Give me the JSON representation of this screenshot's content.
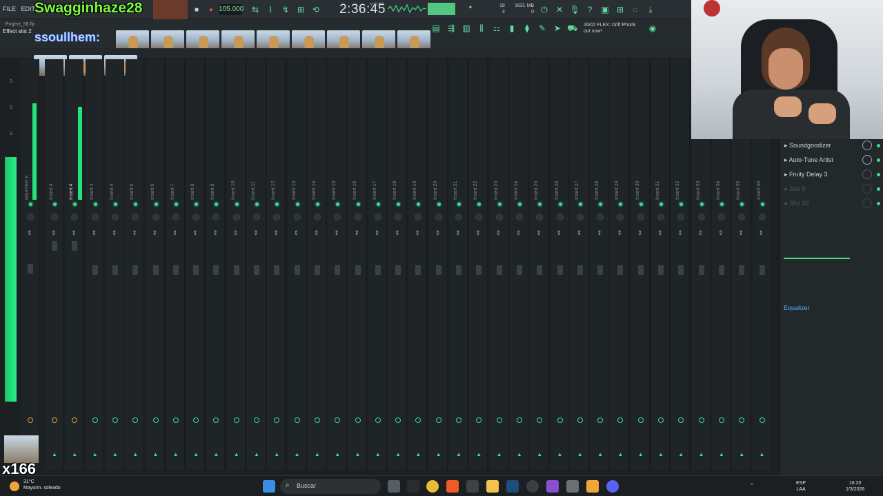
{
  "toolbar": {
    "menu": [
      "FILE",
      "EDIT",
      "AD"
    ],
    "tempo": "105.000",
    "time": "2:36:45",
    "time_sub": "M:S:CS",
    "cpu_num": "18",
    "cpu_voices": "3",
    "memory_mb": "1631 MB",
    "memory_val": "0",
    "news_line1": "26/02  FLEX: Drift Phonk",
    "news_line2": "out now!"
  },
  "project": {
    "name": "Project_56.flp",
    "slot": "Effect slot 2"
  },
  "chat": {
    "user1": "Swagginhaze28",
    "user2": "ssoullhem:"
  },
  "mixer": {
    "master_label": "MASTER K",
    "insert_labels": [
      "Insert 4",
      "Insert 4",
      "Insert 3",
      "Insert 4",
      "Insert 5",
      "Insert 6",
      "Insert 7",
      "Insert 8",
      "Insert 9",
      "Insert 10",
      "Insert 11",
      "Insert 12",
      "Insert 13",
      "Insert 14",
      "Insert 15",
      "Insert 16",
      "Insert 17",
      "Insert 18",
      "Insert 19",
      "Insert 20",
      "Insert 21",
      "Insert 22",
      "Insert 23",
      "Insert 24",
      "Insert 25",
      "Insert 26",
      "Insert 27",
      "Insert 28",
      "Insert 29",
      "Insert 30",
      "Insert 31",
      "Insert 32",
      "Insert 33",
      "Insert 34",
      "Insert 35",
      "Insert 36"
    ],
    "meter_scale": [
      "3",
      "0",
      "3"
    ]
  },
  "fx": {
    "slots": [
      "Soundgoodizer",
      "Auto-Tune Artist",
      "Fruity Delay 3",
      "Slot 9",
      "Slot 10"
    ],
    "eq_label": "Equalizer"
  },
  "overlay": {
    "counter": "x166"
  },
  "taskbar": {
    "weather_temp": "31°C",
    "weather_desc": "Mayorm. soleado",
    "search_placeholder": "Buscar",
    "lang1": "ESP",
    "lang2": "LAA",
    "clock_time": "16:20",
    "clock_date": "1/3/2026"
  }
}
